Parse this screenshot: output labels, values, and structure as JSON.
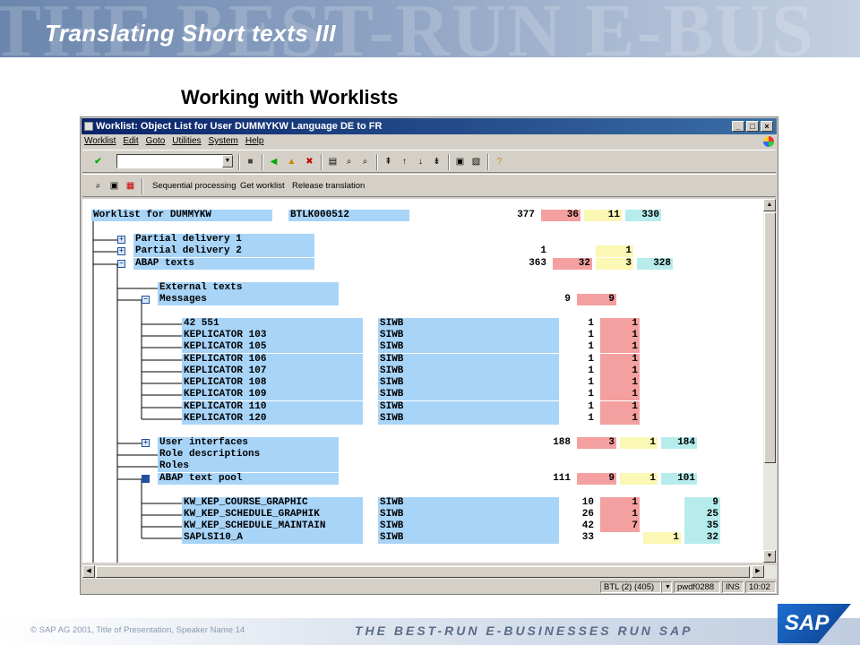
{
  "slide": {
    "header_watermark": "THE BEST-RUN E-BUS",
    "title": "Translating Short texts III",
    "subtitle": "Working with Worklists",
    "footer": "SAP AG 2001, Title of Presentation, Speaker Name  14",
    "tagline": "THE BEST-RUN E-BUSINESSES RUN SAP",
    "logo": "SAP"
  },
  "window": {
    "title": "Worklist: Object List for User DUMMYKW Language DE to FR",
    "menu": [
      "Worklist",
      "Edit",
      "Goto",
      "Utilities",
      "System",
      "Help"
    ],
    "app_buttons": [
      "Sequential processing",
      "Get worklist",
      "Release translation"
    ],
    "status": {
      "system": "BTL (2) (405)",
      "server": "pwdf0288",
      "mode": "INS",
      "time": "10:02"
    }
  },
  "colors": {
    "name_cell": "#a8d4f8",
    "red": "#f4a0a0",
    "yellow": "#fbf7b4",
    "cyan": "#b6ecec"
  },
  "tree": [
    {
      "name": "Worklist for DUMMYKW",
      "obj": "BTLK000512",
      "total": "377",
      "red": "36",
      "yel": "11",
      "cyan": "330"
    },
    {
      "name": "Partial delivery 1",
      "obj": "",
      "total": "",
      "red": "",
      "yel": "",
      "cyan": ""
    },
    {
      "name": "Partial delivery 2",
      "obj": "",
      "total": "1",
      "red": "",
      "yel": "1",
      "cyan": ""
    },
    {
      "name": "ABAP texts",
      "obj": "",
      "total": "363",
      "red": "32",
      "yel": "3",
      "cyan": "328"
    },
    {
      "name": "External texts",
      "obj": "",
      "total": "",
      "red": "",
      "yel": "",
      "cyan": ""
    },
    {
      "name": "Messages",
      "obj": "",
      "total": "9",
      "red": "9",
      "yel": "",
      "cyan": ""
    },
    {
      "name": "42 551",
      "obj": "SIWB",
      "total": "1",
      "red": "1",
      "yel": "",
      "cyan": ""
    },
    {
      "name": "KEPLICATOR 103",
      "obj": "SIWB",
      "total": "1",
      "red": "1",
      "yel": "",
      "cyan": ""
    },
    {
      "name": "KEPLICATOR 105",
      "obj": "SIWB",
      "total": "1",
      "red": "1",
      "yel": "",
      "cyan": ""
    },
    {
      "name": "KEPLICATOR 106",
      "obj": "SIWB",
      "total": "1",
      "red": "1",
      "yel": "",
      "cyan": ""
    },
    {
      "name": "KEPLICATOR 107",
      "obj": "SIWB",
      "total": "1",
      "red": "1",
      "yel": "",
      "cyan": ""
    },
    {
      "name": "KEPLICATOR 108",
      "obj": "SIWB",
      "total": "1",
      "red": "1",
      "yel": "",
      "cyan": ""
    },
    {
      "name": "KEPLICATOR 109",
      "obj": "SIWB",
      "total": "1",
      "red": "1",
      "yel": "",
      "cyan": ""
    },
    {
      "name": "KEPLICATOR 110",
      "obj": "SIWB",
      "total": "1",
      "red": "1",
      "yel": "",
      "cyan": ""
    },
    {
      "name": "KEPLICATOR 120",
      "obj": "SIWB",
      "total": "1",
      "red": "1",
      "yel": "",
      "cyan": ""
    },
    {
      "name": "User interfaces",
      "obj": "",
      "total": "188",
      "red": "3",
      "yel": "1",
      "cyan": "184"
    },
    {
      "name": "Role descriptions",
      "obj": "",
      "total": "",
      "red": "",
      "yel": "",
      "cyan": ""
    },
    {
      "name": "Roles",
      "obj": "",
      "total": "",
      "red": "",
      "yel": "",
      "cyan": ""
    },
    {
      "name": "ABAP text pool",
      "obj": "",
      "total": "111",
      "red": "9",
      "yel": "1",
      "cyan": "101"
    },
    {
      "name": "KW_KEP_COURSE_GRAPHIC",
      "obj": "SIWB",
      "total": "10",
      "red": "1",
      "yel": "",
      "cyan": "9"
    },
    {
      "name": "KW_KEP_SCHEDULE_GRAPHIK",
      "obj": "SIWB",
      "total": "26",
      "red": "1",
      "yel": "",
      "cyan": "25"
    },
    {
      "name": "KW_KEP_SCHEDULE_MAINTAIN",
      "obj": "SIWB",
      "total": "42",
      "red": "7",
      "yel": "",
      "cyan": "35"
    },
    {
      "name": "SAPLSI10_A",
      "obj": "SIWB",
      "total": "33",
      "red": "",
      "yel": "1",
      "cyan": "32"
    }
  ]
}
